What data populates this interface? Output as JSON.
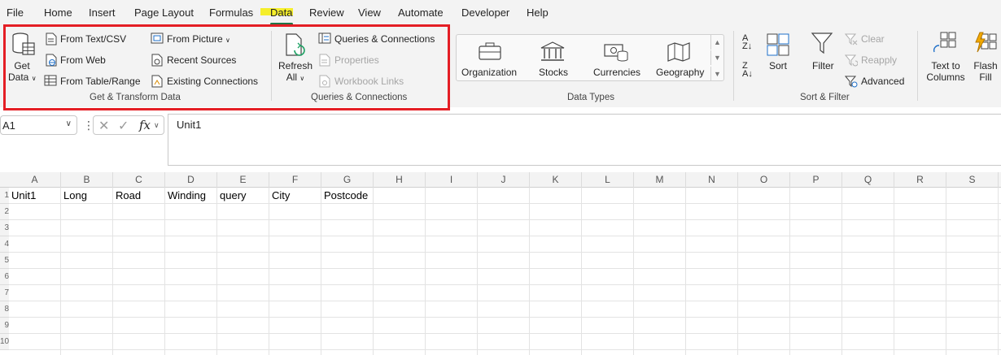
{
  "menu": {
    "tabs": [
      "File",
      "Home",
      "Insert",
      "Page Layout",
      "Formulas",
      "Data",
      "Review",
      "View",
      "Automate",
      "Developer",
      "Help"
    ],
    "active": "Data"
  },
  "ribbon": {
    "get_transform": {
      "get_data_line1": "Get",
      "get_data_line2": "Data",
      "from_text_csv": "From Text/CSV",
      "from_web": "From Web",
      "from_table_range": "From Table/Range",
      "from_picture": "From Picture",
      "recent_sources": "Recent Sources",
      "existing_connections": "Existing Connections",
      "group_label": "Get & Transform Data"
    },
    "queries": {
      "refresh_line1": "Refresh",
      "refresh_line2": "All",
      "queries_connections": "Queries & Connections",
      "properties": "Properties",
      "workbook_links": "Workbook Links",
      "group_label": "Queries & Connections"
    },
    "data_types": {
      "items": [
        "Organization",
        "Stocks",
        "Currencies",
        "Geography"
      ],
      "group_label": "Data Types"
    },
    "sort_filter": {
      "sort": "Sort",
      "filter": "Filter",
      "clear": "Clear",
      "reapply": "Reapply",
      "advanced": "Advanced",
      "group_label": "Sort & Filter"
    },
    "data_tools": {
      "text_to_columns_line1": "Text to",
      "text_to_columns_line2": "Columns",
      "flash_fill_line1": "Flash",
      "flash_fill_line2": "Fill"
    }
  },
  "formula_bar": {
    "name_box": "A1",
    "fx": "fx",
    "content": "Unit1"
  },
  "grid": {
    "columns": [
      "A",
      "B",
      "C",
      "D",
      "E",
      "F",
      "G",
      "H",
      "I",
      "J",
      "K",
      "L",
      "M",
      "N",
      "O",
      "P",
      "Q",
      "R",
      "S"
    ],
    "rows": [
      "1",
      "2",
      "3",
      "4",
      "5",
      "6",
      "7",
      "8",
      "9",
      "10"
    ],
    "row1_values": [
      "Unit1",
      "Long",
      "Road",
      "Winding",
      "query",
      "City",
      "Postcode"
    ]
  },
  "colors": {
    "accent": "#217346",
    "highlight_box": "#e41e25",
    "tab_highlight": "#f5ee2b"
  }
}
